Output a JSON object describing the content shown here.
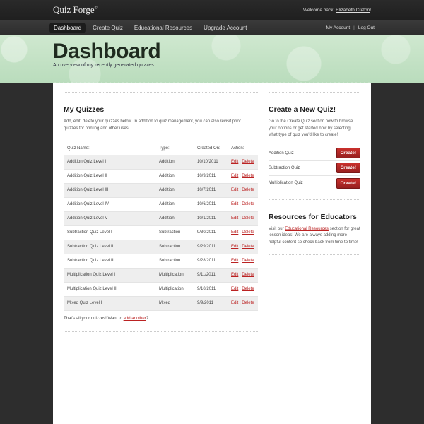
{
  "app": {
    "logo": "Quiz Forge",
    "logo_mark": "©",
    "welcome_prefix": "Welcome back,",
    "user_name": "Elizabeth Creton",
    "welcome_suffix": "!"
  },
  "nav": {
    "items": [
      {
        "label": "Dashboard",
        "active": true
      },
      {
        "label": "Create Quiz",
        "active": false
      },
      {
        "label": "Educational Resources",
        "active": false
      },
      {
        "label": "Upgrade Account",
        "active": false
      }
    ],
    "my_account": "My Account",
    "separator": "|",
    "logout": "Log Out"
  },
  "hero": {
    "title": "Dashboard",
    "subtitle": "An overview of my recently generated quizzes."
  },
  "my_quizzes": {
    "heading": "My Quizzes",
    "description": "Add, edit, delete your quizzes below. In addition to quiz management, you can also revisit prior quizzes for printing and other uses.",
    "columns": [
      "Quiz Name:",
      "Type:",
      "Created On:",
      "Action:"
    ],
    "edit_label": "Edit",
    "delete_label": "Delete",
    "action_sep": "|",
    "rows": [
      {
        "name": "Addition Quiz Level I",
        "type": "Addition",
        "date": "10/10/2011"
      },
      {
        "name": "Addition Quiz Level II",
        "type": "Addition",
        "date": "10/9/2011"
      },
      {
        "name": "Addition Quiz Level III",
        "type": "Addition",
        "date": "10/7/2011"
      },
      {
        "name": "Addition Quiz Level IV",
        "type": "Addition",
        "date": "10/6/2011"
      },
      {
        "name": "Addition Quiz Level V",
        "type": "Addition",
        "date": "10/1/2011"
      },
      {
        "name": "Subtraction Quiz Level I",
        "type": "Subtraction",
        "date": "9/30/2011"
      },
      {
        "name": "Subtraction Quiz Level II",
        "type": "Subtraction",
        "date": "9/29/2011"
      },
      {
        "name": "Subtraction Quiz Level III",
        "type": "Subtraction",
        "date": "9/28/2011"
      },
      {
        "name": "Multiplication Quiz Level I",
        "type": "Multiplication",
        "date": "9/11/2011"
      },
      {
        "name": "Multiplication Quiz Level II",
        "type": "Multiplication",
        "date": "9/10/2011"
      },
      {
        "name": "Mixed Quiz Level I",
        "type": "Mixed",
        "date": "9/9/2011"
      }
    ],
    "footer_prefix": "That's all your quizzes! Want to ",
    "footer_link": "add another",
    "footer_suffix": "?"
  },
  "create_quiz": {
    "heading": "Create a New Quiz!",
    "description": "Go to the Create Quiz section now to browse your options or get started now by selecting what type of quiz you'd like to create!",
    "button_label": "Create!",
    "options": [
      "Addition Quiz",
      "Subtraction Quiz",
      "Multiplication Quiz"
    ]
  },
  "resources": {
    "heading": "Resources for Educators",
    "text_prefix": "Visit our ",
    "link": "Educational Resources",
    "text_suffix": " section for great lesson ideas! We are always adding more helpful content so check back from time to time!"
  },
  "colors": {
    "accent_red": "#b22222",
    "hero_green": "#c4e2c6",
    "dark_bg": "#2d2d2d"
  }
}
